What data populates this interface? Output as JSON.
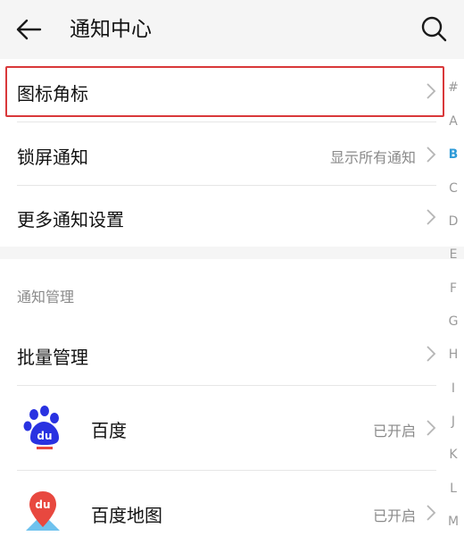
{
  "header": {
    "title": "通知中心",
    "back_icon": "arrow-left-icon",
    "search_icon": "search-icon"
  },
  "settings": {
    "badge_label": "图标角标",
    "lockscreen_label": "锁屏通知",
    "lockscreen_value": "显示所有通知",
    "more_label": "更多通知设置"
  },
  "management": {
    "section_title": "通知管理",
    "batch_label": "批量管理"
  },
  "apps": [
    {
      "name": "百度",
      "status": "已开启",
      "icon": "baidu-paw-icon"
    },
    {
      "name": "百度地图",
      "status": "已开启",
      "icon": "baidu-map-pin-icon"
    }
  ],
  "index_letters": [
    "#",
    "A",
    "B",
    "C",
    "D",
    "E",
    "F",
    "G",
    "H",
    "I",
    "J",
    "K",
    "L",
    "M"
  ],
  "active_letter": "B",
  "colors": {
    "highlight_border": "#d9383a",
    "index_active": "#2f9bd8",
    "baidu_blue": "#2932e1",
    "map_red": "#e8483f"
  }
}
